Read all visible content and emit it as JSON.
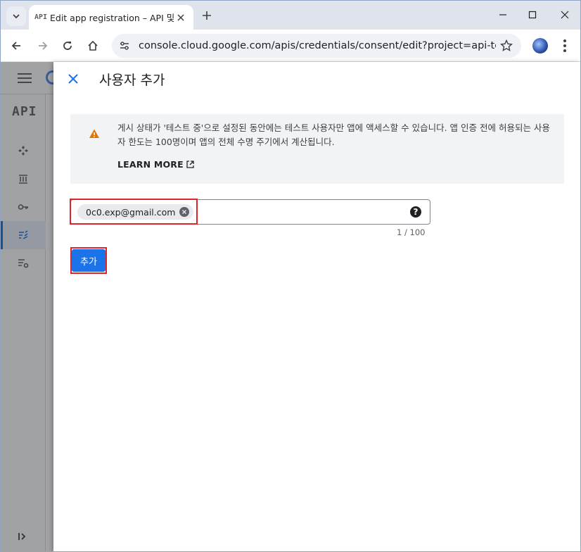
{
  "browser": {
    "tab": {
      "favicon_text": "API",
      "title": "Edit app registration – API 및"
    },
    "address_bar": {
      "url": "console.cloud.google.com/apis/credentials/consent/edit?project=api-test-429..."
    }
  },
  "console": {
    "product_label": "API",
    "nav_icons": [
      "apps-icon",
      "library-icon",
      "key-icon",
      "consent-icon",
      "settings-list-icon"
    ]
  },
  "panel": {
    "title": "사용자 추가",
    "alert": {
      "text": "게시 상태가 '테스트 중'으로 설정된 동안에는 테스트 사용자만 앱에 액세스할 수 있습니다. 앱 인증 전에 허용되는 사용자 한도는 100명이며 앱의 전체 수명 주기에서 계산됩니다.",
      "learn_more": "LEARN MORE"
    },
    "email_input": {
      "chip_value": "0c0.exp@gmail.com",
      "help_symbol": "?",
      "counter": "1 / 100"
    },
    "add_button_label": "추가"
  },
  "colors": {
    "primary": "#1a73e8",
    "highlight": "#e0242a",
    "warning": "#e37400"
  }
}
